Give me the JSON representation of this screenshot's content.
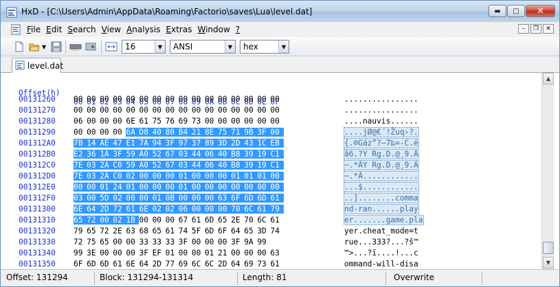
{
  "window": {
    "title": "HxD - [C:\\Users\\Admin\\AppData\\Roaming\\Factorio\\saves\\Lua\\level.dat]",
    "minimize_glyph": "▬",
    "maximize_glyph": "□",
    "close_glyph": "✕"
  },
  "menu": {
    "items": [
      {
        "underline": "F",
        "rest": "ile"
      },
      {
        "underline": "E",
        "rest": "dit"
      },
      {
        "underline": "S",
        "rest": "earch"
      },
      {
        "underline": "V",
        "rest": "iew"
      },
      {
        "underline": "A",
        "rest": "nalysis"
      },
      {
        "underline": "E",
        "rest": "xtras"
      },
      {
        "underline": "W",
        "rest": "indow"
      },
      {
        "underline": "?",
        "rest": ""
      }
    ],
    "mdi_min": "–",
    "mdi_restore": "❐",
    "mdi_close": "✕"
  },
  "toolbar": {
    "bytes_per_row": "16",
    "charset": "ANSI",
    "offset_base": "hex"
  },
  "tab": {
    "label": "level.dat"
  },
  "hex": {
    "header_offset": "Offset(h)",
    "header_cols": [
      "00",
      "01",
      "02",
      "03",
      "04",
      "05",
      "06",
      "07",
      "08",
      "09",
      "0A",
      "0B",
      "0C",
      "0D",
      "0E",
      "0F"
    ],
    "rows": [
      {
        "offset": "00131260",
        "bytes": [
          "00",
          "00",
          "00",
          "00",
          "00",
          "00",
          "00",
          "00",
          "00",
          "00",
          "00",
          "00",
          "00",
          "00",
          "00",
          "00"
        ],
        "ascii": "................"
      },
      {
        "offset": "00131270",
        "bytes": [
          "00",
          "00",
          "00",
          "00",
          "00",
          "00",
          "00",
          "00",
          "00",
          "00",
          "00",
          "00",
          "00",
          "00",
          "00",
          "00"
        ],
        "ascii": "................"
      },
      {
        "offset": "00131280",
        "bytes": [
          "06",
          "00",
          "00",
          "00",
          "6E",
          "61",
          "75",
          "76",
          "69",
          "73",
          "00",
          "00",
          "00",
          "00",
          "00",
          "00"
        ],
        "ascii": "....nauvis......"
      },
      {
        "offset": "00131290",
        "bytes": [
          "00",
          "00",
          "00",
          "00",
          "6A",
          "D8",
          "40",
          "80",
          "B4",
          "21",
          "8E",
          "75",
          "71",
          "9B",
          "3F",
          "00"
        ],
        "ascii": "....jØ@€´!Žuq›?."
      },
      {
        "offset": "001312A0",
        "bytes": [
          "7B",
          "14",
          "AE",
          "47",
          "E1",
          "7A",
          "94",
          "3F",
          "97",
          "37",
          "89",
          "3D",
          "2D",
          "43",
          "1C",
          "EB"
        ],
        "ascii": "{.®Gáz”?—7‰=-C.ë"
      },
      {
        "offset": "001312B0",
        "bytes": [
          "E2",
          "36",
          "1A",
          "3F",
          "59",
          "A0",
          "52",
          "67",
          "03",
          "44",
          "06",
          "40",
          "B8",
          "39",
          "19",
          "C1"
        ],
        "ascii": "â6.?Y Rg.D.@¸9.Á"
      },
      {
        "offset": "001312C0",
        "bytes": [
          "7E",
          "03",
          "2A",
          "C0",
          "59",
          "A0",
          "52",
          "67",
          "03",
          "44",
          "06",
          "40",
          "B8",
          "39",
          "19",
          "C1"
        ],
        "ascii": "~.*ÀY Rg.D.@¸9.Á"
      },
      {
        "offset": "001312D0",
        "bytes": [
          "7E",
          "03",
          "2A",
          "C0",
          "02",
          "00",
          "00",
          "00",
          "01",
          "00",
          "00",
          "00",
          "01",
          "01",
          "01",
          "00"
        ],
        "ascii": "~.*À............"
      },
      {
        "offset": "001312E0",
        "bytes": [
          "00",
          "00",
          "01",
          "24",
          "01",
          "00",
          "00",
          "00",
          "01",
          "00",
          "00",
          "00",
          "00",
          "00",
          "00",
          "00"
        ],
        "ascii": "...$............"
      },
      {
        "offset": "001312F0",
        "bytes": [
          "03",
          "00",
          "5D",
          "02",
          "00",
          "00",
          "01",
          "0B",
          "00",
          "00",
          "00",
          "63",
          "6F",
          "6D",
          "6D",
          "61"
        ],
        "ascii": "..]........comma"
      },
      {
        "offset": "00131300",
        "bytes": [
          "6E",
          "64",
          "2D",
          "72",
          "61",
          "6E",
          "02",
          "02",
          "06",
          "00",
          "00",
          "00",
          "70",
          "6C",
          "61",
          "79"
        ],
        "ascii": "nd-ran......play"
      },
      {
        "offset": "00131310",
        "bytes": [
          "65",
          "72",
          "00",
          "02",
          "1B",
          "00",
          "00",
          "00",
          "67",
          "61",
          "6D",
          "65",
          "2E",
          "70",
          "6C",
          "61"
        ],
        "ascii": "er.......game.pla"
      },
      {
        "offset": "00131320",
        "bytes": [
          "79",
          "65",
          "72",
          "2E",
          "63",
          "68",
          "65",
          "61",
          "74",
          "5F",
          "6D",
          "6F",
          "64",
          "65",
          "3D",
          "74"
        ],
        "ascii": "yer.cheat_mode=t"
      },
      {
        "offset": "00131330",
        "bytes": [
          "72",
          "75",
          "65",
          "00",
          "00",
          "33",
          "33",
          "33",
          "3F",
          "00",
          "00",
          "00",
          "3F",
          "9A",
          "99"
        ],
        "ascii": "rue...333?...?š™"
      },
      {
        "offset": "00131340",
        "bytes": [
          "99",
          "3E",
          "00",
          "00",
          "00",
          "3F",
          "EF",
          "01",
          "00",
          "00",
          "01",
          "21",
          "00",
          "00",
          "00",
          "63"
        ],
        "ascii": "™>...?ï....!...c"
      },
      {
        "offset": "00131350",
        "bytes": [
          "6F",
          "6D",
          "6D",
          "61",
          "6E",
          "64",
          "2D",
          "77",
          "69",
          "6C",
          "6C",
          "2D",
          "64",
          "69",
          "73",
          "61"
        ],
        "ascii": "ommand-will-disa"
      }
    ]
  },
  "status": {
    "offset": "Offset: 131294",
    "block": "Block: 131294-131314",
    "length": "Length: 81",
    "mode": "Overwrite"
  },
  "colors": {
    "offset_blue": "#1a2fd6",
    "selection": "#3399ff"
  }
}
